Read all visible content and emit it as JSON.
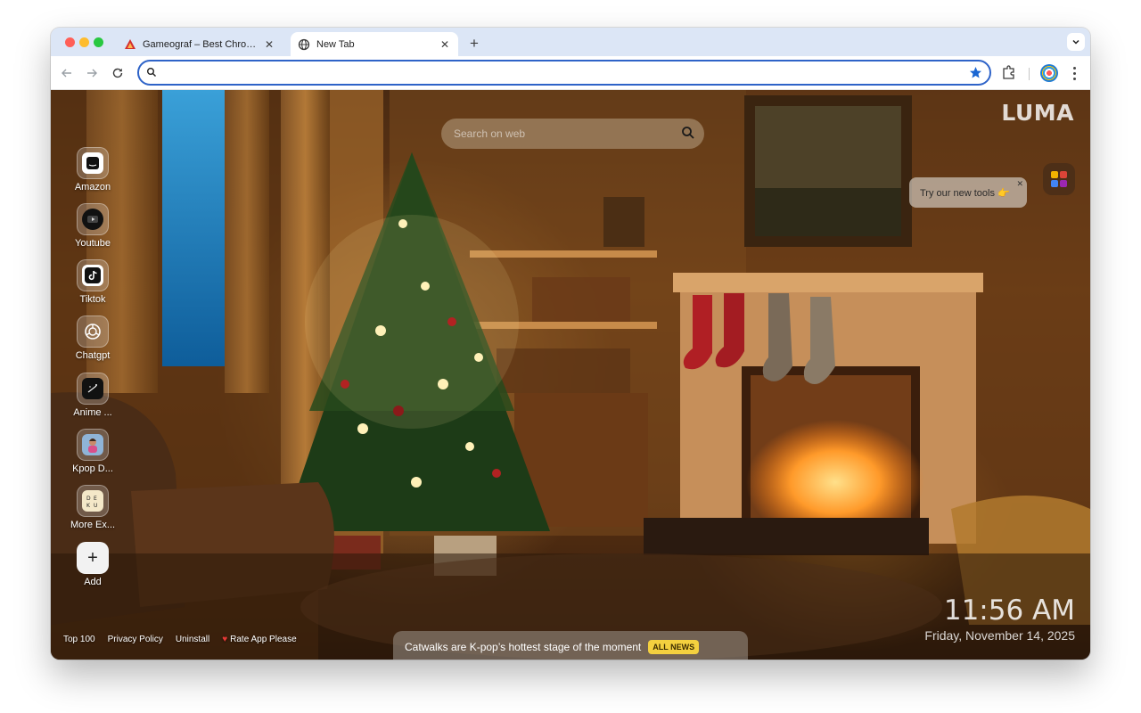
{
  "browser": {
    "tabs": [
      {
        "title": "Gameograf – Best Chrome Live Wallpapers",
        "active": false
      },
      {
        "title": "New Tab",
        "active": true
      }
    ],
    "omnibox_value": ""
  },
  "page": {
    "brand": "LUMA",
    "search_placeholder": "Search on web",
    "tooltip": "Try our new tools 👉",
    "shortcuts": [
      {
        "label": "Amazon",
        "icon": "amazon-icon"
      },
      {
        "label": "Youtube",
        "icon": "youtube-icon"
      },
      {
        "label": "Tiktok",
        "icon": "tiktok-icon"
      },
      {
        "label": "Chatgpt",
        "icon": "chatgpt-icon"
      },
      {
        "label": "Anime ...",
        "icon": "anime-icon"
      },
      {
        "label": "Kpop D...",
        "icon": "kpop-icon"
      },
      {
        "label": "More Ex...",
        "icon": "more-extensions-icon"
      },
      {
        "label": "Add",
        "icon": "plus-icon"
      }
    ],
    "time": "11:56 AM",
    "date": "Friday, November 14, 2025",
    "footer_links": [
      "Top 100",
      "Privacy Policy",
      "Uninstall",
      "Rate App Please"
    ],
    "news_text": "Catwalks are K-pop’s hottest stage of the moment",
    "news_badge": "ALL NEWS"
  },
  "colors": {
    "accent": "#2e63c8",
    "badge": "#f4d03f"
  }
}
